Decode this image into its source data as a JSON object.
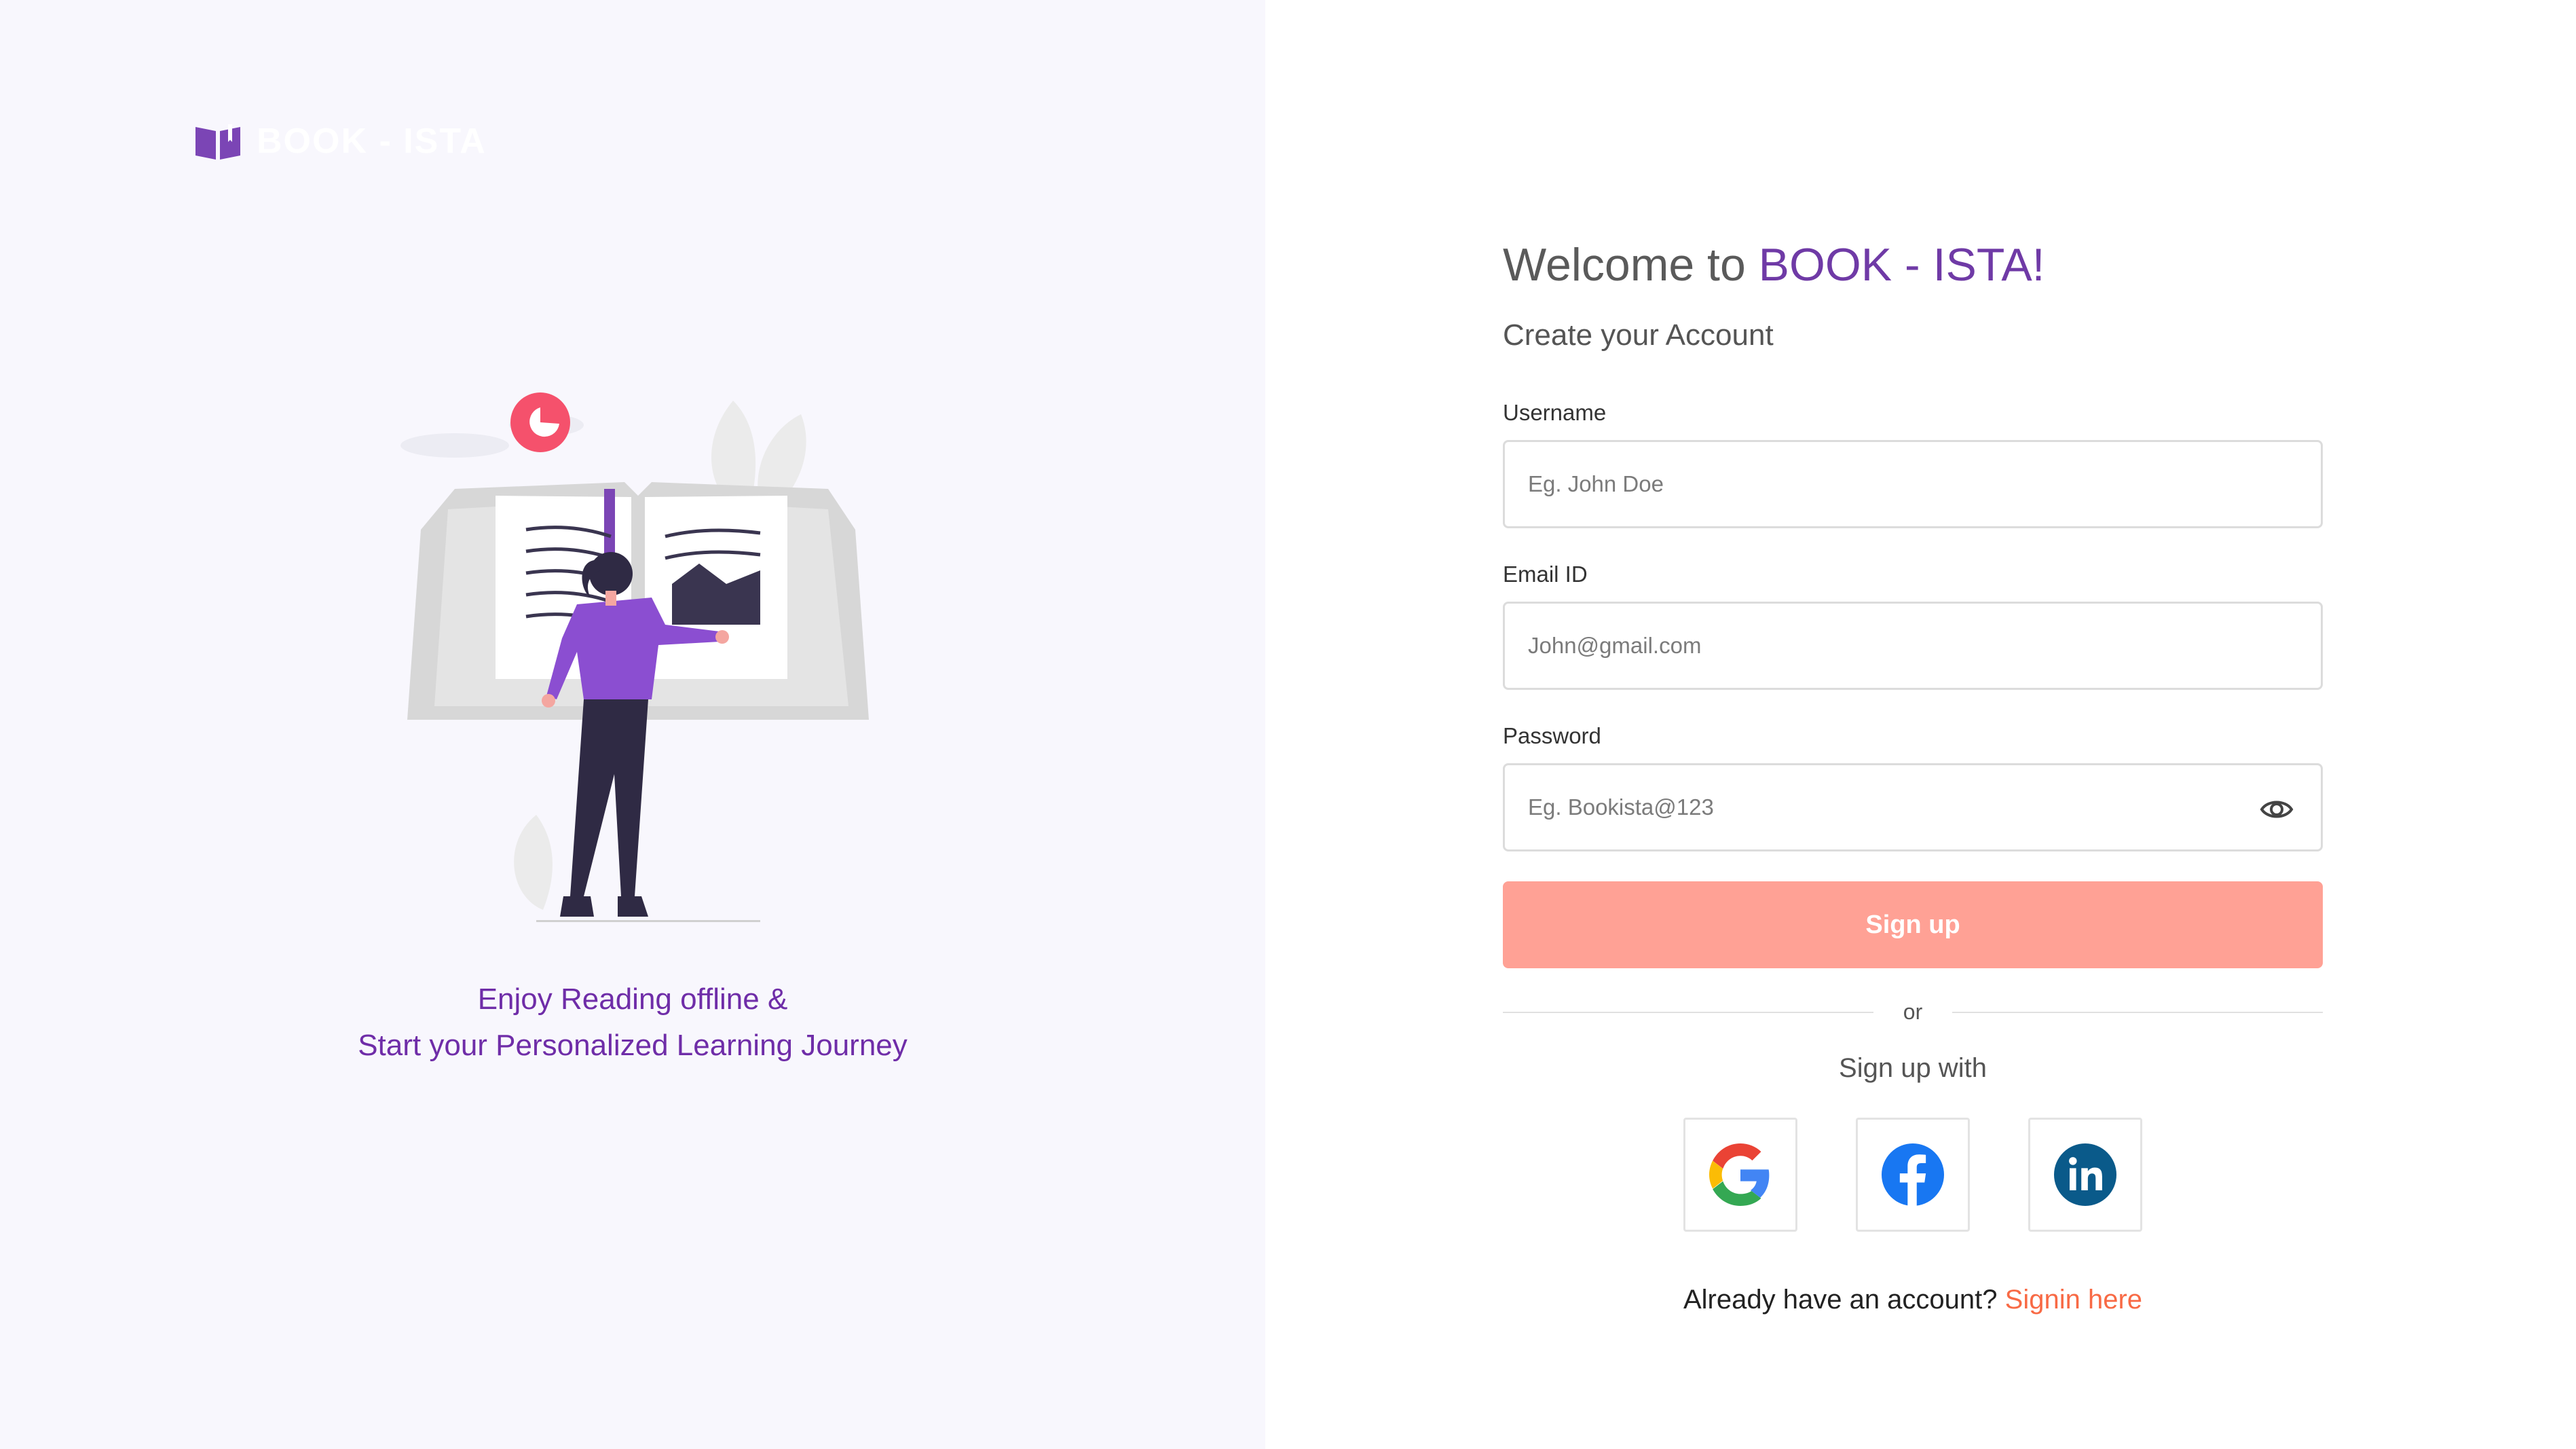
{
  "brand": {
    "logo_text": "BOOK - ISTA",
    "icon": "open-book-icon",
    "accent": "#6f3aa6"
  },
  "left": {
    "tagline_line1": "Enjoy Reading offline &",
    "tagline_line2": "Start your Personalized Learning Journey"
  },
  "form": {
    "welcome_prefix": "Welcome to ",
    "welcome_brand": "BOOK - ISTA!",
    "subtitle": "Create your Account",
    "username": {
      "label": "Username",
      "placeholder": "Eg. John Doe",
      "value": ""
    },
    "email": {
      "label": "Email ID",
      "placeholder": "John@gmail.com",
      "value": ""
    },
    "password": {
      "label": "Password",
      "placeholder": "Eg. Bookista@123",
      "value": "",
      "toggle_icon": "eye-icon"
    },
    "signup_label": "Sign up",
    "or_label": "or",
    "signup_with_label": "Sign up with",
    "socials": [
      {
        "name": "Google",
        "icon": "google-icon"
      },
      {
        "name": "Facebook",
        "icon": "facebook-icon"
      },
      {
        "name": "LinkedIn",
        "icon": "linkedin-icon"
      }
    ],
    "signin_prompt": "Already have an account? ",
    "signin_link": "Signin here"
  },
  "colors": {
    "left_bg": "#f8f7fd",
    "tagline": "#6f2da8",
    "signup_button": "#ffa195",
    "link": "#f86a45"
  }
}
